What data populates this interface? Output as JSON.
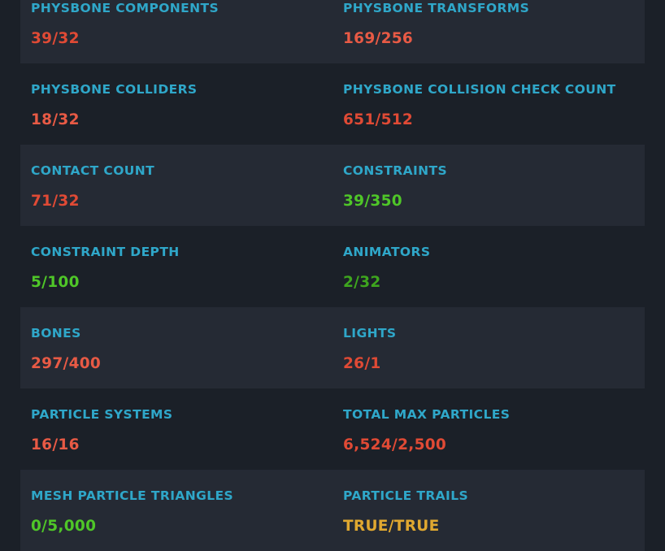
{
  "colors": {
    "label": "#2fa7c9",
    "over_limit": "#e04a35",
    "within_limit": "#4fc628",
    "good_dark": "#3ea51e",
    "warning": "#e0a830"
  },
  "rows": [
    {
      "shaded": true,
      "left": {
        "label": "PHYSBONE COMPONENTS",
        "value": "39/32",
        "color": "#e04a35"
      },
      "right": {
        "label": "PHYSBONE TRANSFORMS",
        "value": "169/256",
        "color": "#e85a45"
      }
    },
    {
      "shaded": false,
      "left": {
        "label": "PHYSBONE COLLIDERS",
        "value": "18/32",
        "color": "#e85a45"
      },
      "right": {
        "label": "PHYSBONE COLLISION CHECK COUNT",
        "value": "651/512",
        "color": "#e04a35"
      }
    },
    {
      "shaded": true,
      "left": {
        "label": "CONTACT COUNT",
        "value": "71/32",
        "color": "#e04a35"
      },
      "right": {
        "label": "CONSTRAINTS",
        "value": "39/350",
        "color": "#4fc628"
      }
    },
    {
      "shaded": false,
      "left": {
        "label": "CONSTRAINT DEPTH",
        "value": "5/100",
        "color": "#4fc628"
      },
      "right": {
        "label": "ANIMATORS",
        "value": "2/32",
        "color": "#3ea51e"
      }
    },
    {
      "shaded": true,
      "left": {
        "label": "BONES",
        "value": "297/400",
        "color": "#e85a45"
      },
      "right": {
        "label": "LIGHTS",
        "value": "26/1",
        "color": "#e04a35"
      }
    },
    {
      "shaded": false,
      "left": {
        "label": "PARTICLE SYSTEMS",
        "value": "16/16",
        "color": "#e85a45"
      },
      "right": {
        "label": "TOTAL MAX PARTICLES",
        "value": "6,524/2,500",
        "color": "#e04a35"
      }
    },
    {
      "shaded": true,
      "left": {
        "label": "MESH PARTICLE TRIANGLES",
        "value": "0/5,000",
        "color": "#4fc628"
      },
      "right": {
        "label": "PARTICLE TRAILS",
        "value": "TRUE/TRUE",
        "color": "#e0a830"
      }
    }
  ]
}
